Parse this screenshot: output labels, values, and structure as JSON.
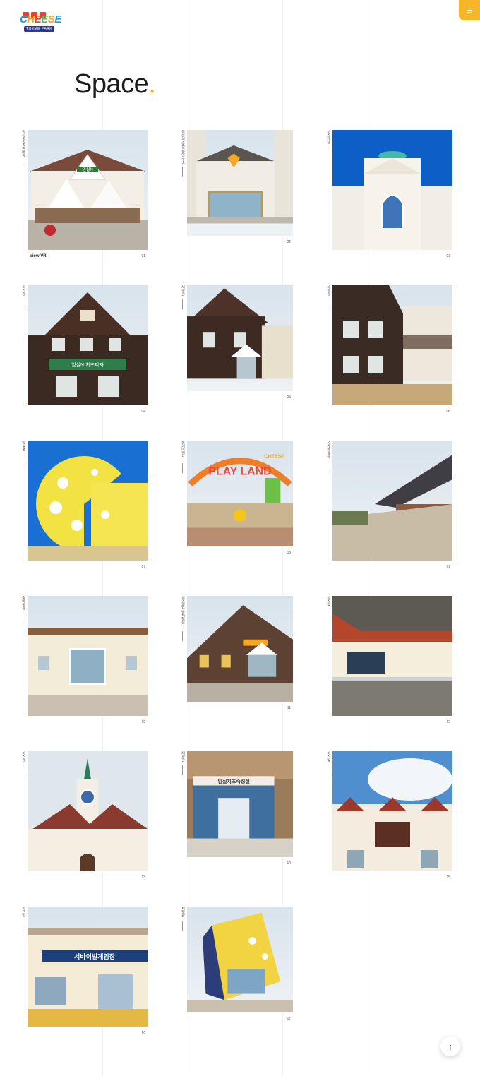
{
  "header": {
    "logo_text": "CHEESE",
    "logo_sub": "THEME PARK",
    "menu_icon": "hamburger-icon",
    "accent": "#f7b62a"
  },
  "page": {
    "title": "Space",
    "title_dot": "."
  },
  "cards": [
    {
      "label": "임실N치즈판매장",
      "number": "01",
      "action": "View VR"
    },
    {
      "label": "임실치즈&식품연구소",
      "number": "02"
    },
    {
      "label": "치즈캐슬",
      "number": "03"
    },
    {
      "label": "치즈관",
      "number": "04"
    },
    {
      "label": "체험관",
      "number": "05"
    },
    {
      "label": "체험관",
      "number": "06"
    },
    {
      "label": "임실홀",
      "number": "07"
    },
    {
      "label": "플레이랜드",
      "number": "08"
    },
    {
      "label": "유가족광장",
      "number": "09"
    },
    {
      "label": "숙박동관",
      "number": "10"
    },
    {
      "label": "치즈피자빵체험장",
      "number": "11"
    },
    {
      "label": "치즈빌",
      "number": "12"
    },
    {
      "label": "치즈관",
      "number": "13"
    },
    {
      "label": "체험관",
      "number": "14"
    },
    {
      "label": "치즈빌",
      "number": "15"
    },
    {
      "label": "치즈빌",
      "number": "16"
    },
    {
      "label": "체험관",
      "number": "17"
    }
  ],
  "signs": {
    "card01": "임실N",
    "card04": "임실N 치즈피자",
    "card08": "PLAY LAND",
    "card08_brand": "CHEESE",
    "card14": "임실치즈숙성실",
    "card16": "서바이벌게임장"
  },
  "back_to_top_icon": "arrow-up-icon"
}
